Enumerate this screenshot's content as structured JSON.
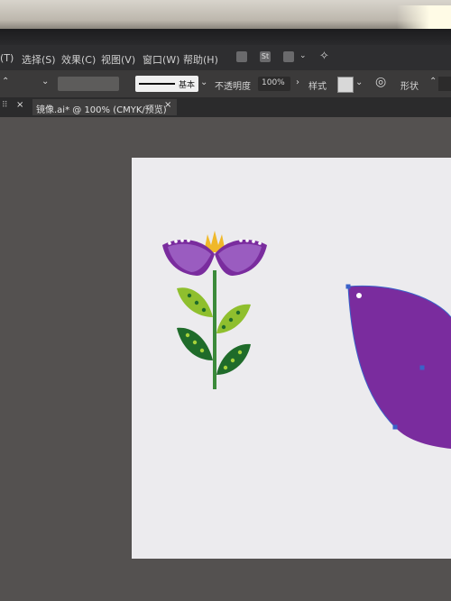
{
  "menu": {
    "items": [
      "(T)",
      "选择(S)",
      "效果(C)",
      "视图(V)",
      "窗口(W)",
      "帮助(H)"
    ],
    "st_icon": "St"
  },
  "control_bar": {
    "stroke_style_label": "基本",
    "opacity_label": "不透明度",
    "opacity_value": "100%",
    "style_label": "样式",
    "shape_label": "形状"
  },
  "document_tab": {
    "title": "镜像.ai* @ 100% (CMYK/预览)",
    "close_glyph": "×"
  },
  "colors": {
    "petal_purple": "#7a2c9e",
    "petal_light": "#9a5cc0",
    "flower_yellow": "#f0b82a",
    "leaf_light": "#8fbf2e",
    "leaf_dark": "#1f6b2a",
    "stem": "#3b8a3a",
    "selection_blue": "#3a62c9"
  }
}
